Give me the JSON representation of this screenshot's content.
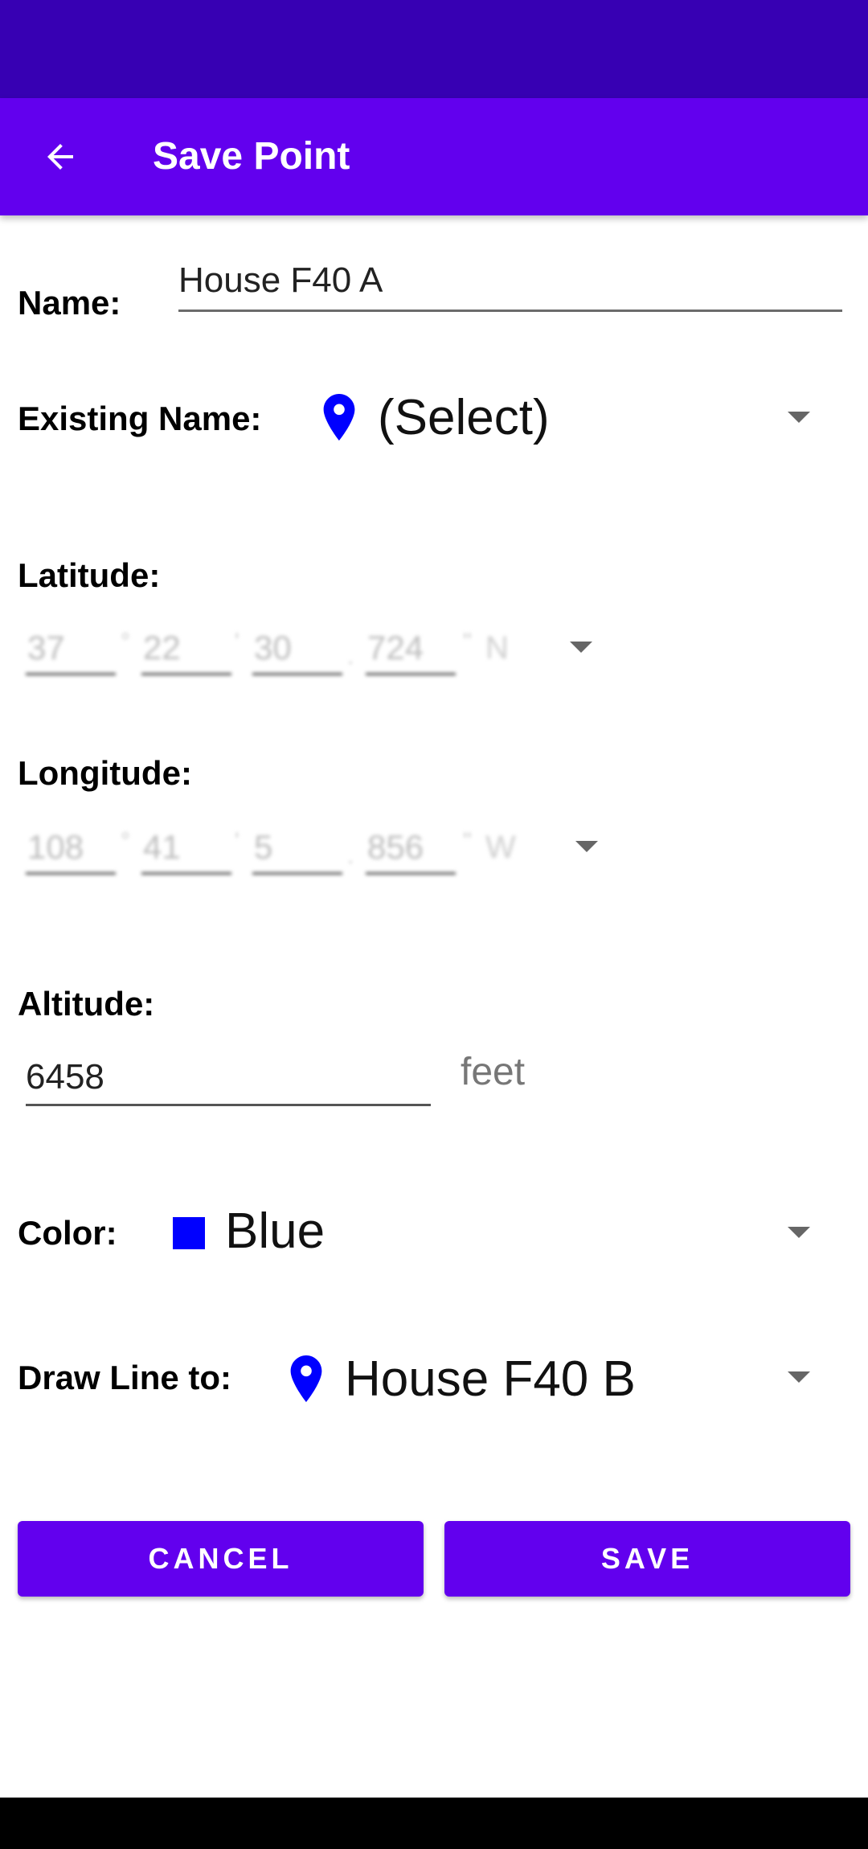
{
  "app_bar": {
    "title": "Save Point",
    "back_icon": "arrow-left-icon",
    "color": "#6200ee"
  },
  "status_bar": {
    "color": "#3700b3"
  },
  "form": {
    "name_label": "Name:",
    "name_value": "House F40 A",
    "existing_name_label": "Existing Name:",
    "existing_name_value": "(Select)",
    "latitude_label": "Latitude:",
    "latitude": {
      "degrees": "37",
      "minutes": "22",
      "seconds": "30",
      "fraction": "724",
      "direction": "N"
    },
    "longitude_label": "Longitude:",
    "longitude": {
      "degrees": "108",
      "minutes": "41",
      "seconds": "5",
      "fraction": "856",
      "direction": "W"
    },
    "altitude_label": "Altitude:",
    "altitude_value": "6458",
    "altitude_unit": "feet",
    "color_label": "Color:",
    "color_value": "Blue",
    "color_swatch": "#0000ff",
    "draw_line_label": "Draw Line to:",
    "draw_line_value": "House F40 B"
  },
  "buttons": {
    "cancel": "CANCEL",
    "save": "SAVE"
  }
}
